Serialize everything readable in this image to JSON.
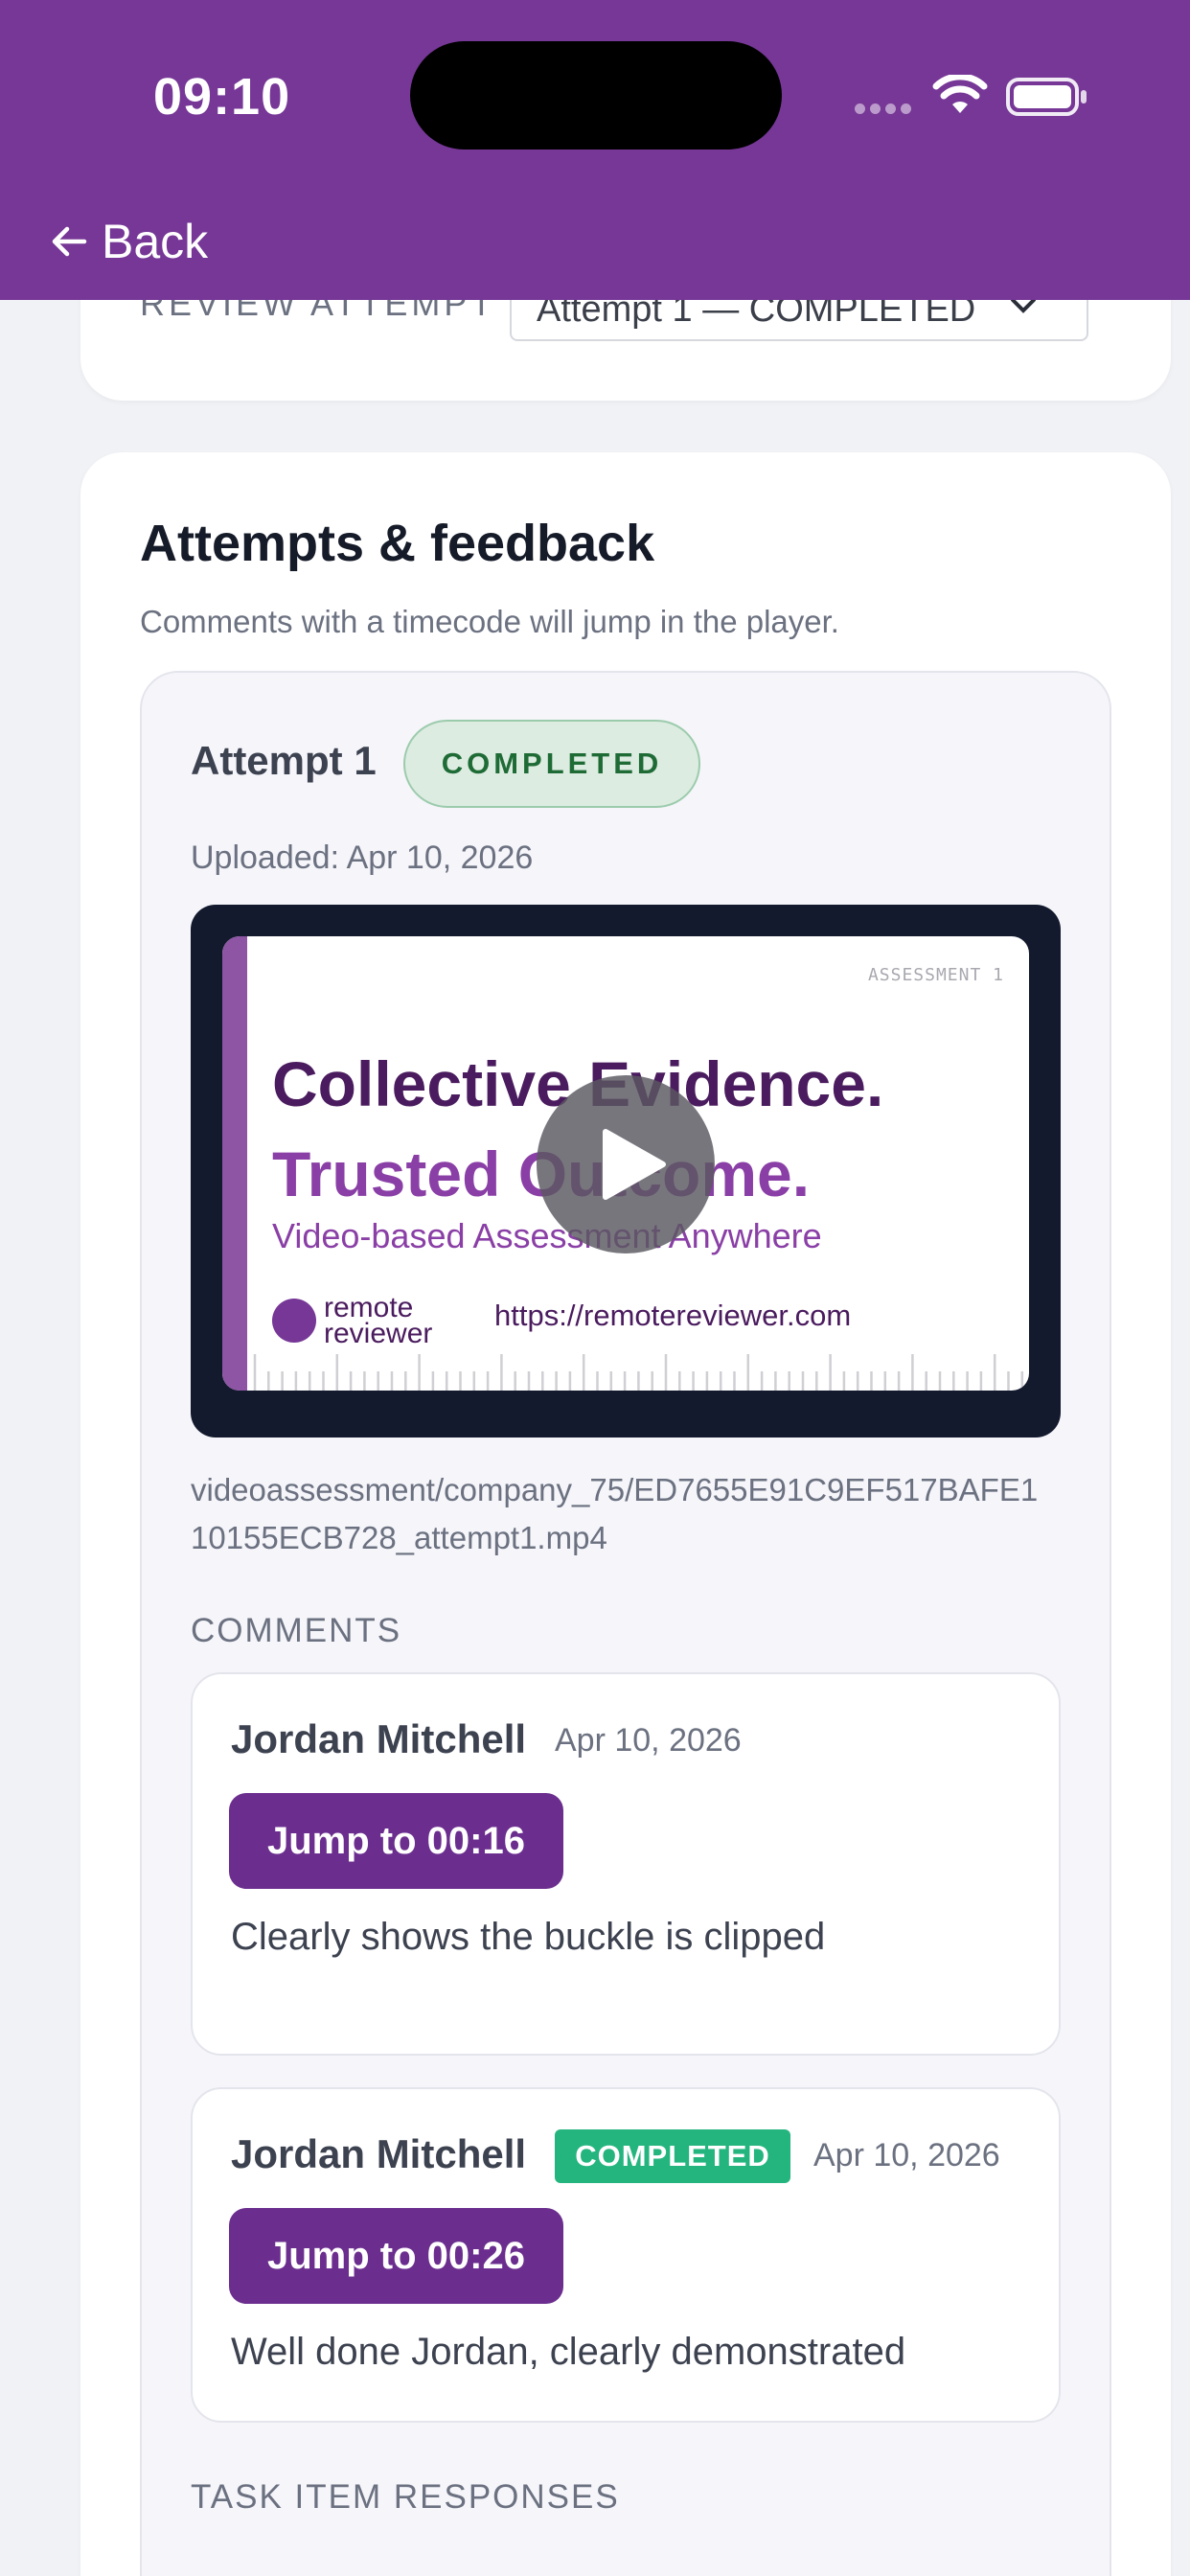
{
  "status_bar": {
    "time": "09:10"
  },
  "nav": {
    "back_label": "Back"
  },
  "review": {
    "label": "REVIEW ATTEMPT",
    "selected_attempt": "Attempt 1 — COMPLETED"
  },
  "section": {
    "title": "Attempts & feedback",
    "subtitle": "Comments with a timecode will jump in the player."
  },
  "attempt": {
    "name": "Attempt 1",
    "status": "COMPLETED",
    "uploaded": "Uploaded: Apr 10, 2026",
    "file_path": "videoassessment/company_75/ED7655E91C9EF517BAFE110155ECB728_attempt1.mp4",
    "video_thumbnail": {
      "tag": "ASSESSMENT 1",
      "headline1": "Collective Evidence.",
      "headline2": "Trusted Outcome.",
      "tagline": "Video-based Assessment Anywhere",
      "logo_text_1": "remote",
      "logo_text_2": "reviewer",
      "url": "https://remotereviewer.com"
    }
  },
  "comments": {
    "heading": "COMMENTS",
    "items": [
      {
        "author": "Jordan Mitchell",
        "date": "Apr 10, 2026",
        "jump_label": "Jump to 00:16",
        "text": "Clearly shows the buckle is clipped"
      },
      {
        "author": "Jordan Mitchell",
        "status": "COMPLETED",
        "date": "Apr 10, 2026",
        "jump_label": "Jump to 00:26",
        "text": "Well done Jordan, clearly demonstrated"
      }
    ]
  },
  "task_items": {
    "heading": "TASK ITEM RESPONSES"
  },
  "colors": {
    "brand": "#763796",
    "jump_button": "#6b2e8e",
    "completed_badge": "#24b57f",
    "completed_pill_bg": "#dcece1"
  },
  "icons": [
    "back-arrow-icon",
    "chevron-down-icon",
    "play-icon",
    "wifi-icon",
    "battery-icon",
    "cellular-signal-icon"
  ]
}
